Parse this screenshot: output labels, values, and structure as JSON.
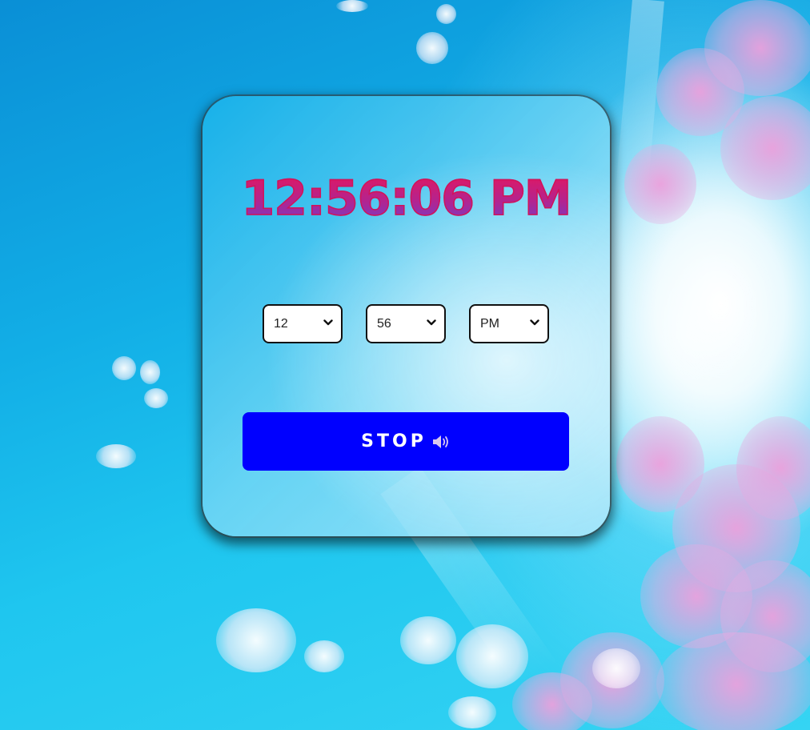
{
  "clock": {
    "time": "12:56:06 PM"
  },
  "alarm": {
    "hour": "12",
    "minute": "56",
    "ampm": "PM"
  },
  "stop_button": {
    "label": "STOP",
    "icon": "speaker-icon"
  },
  "colors": {
    "button": "#0000ff",
    "clock_gradient_top": "#e8155a",
    "clock_gradient_bottom": "#6a3fd0"
  }
}
